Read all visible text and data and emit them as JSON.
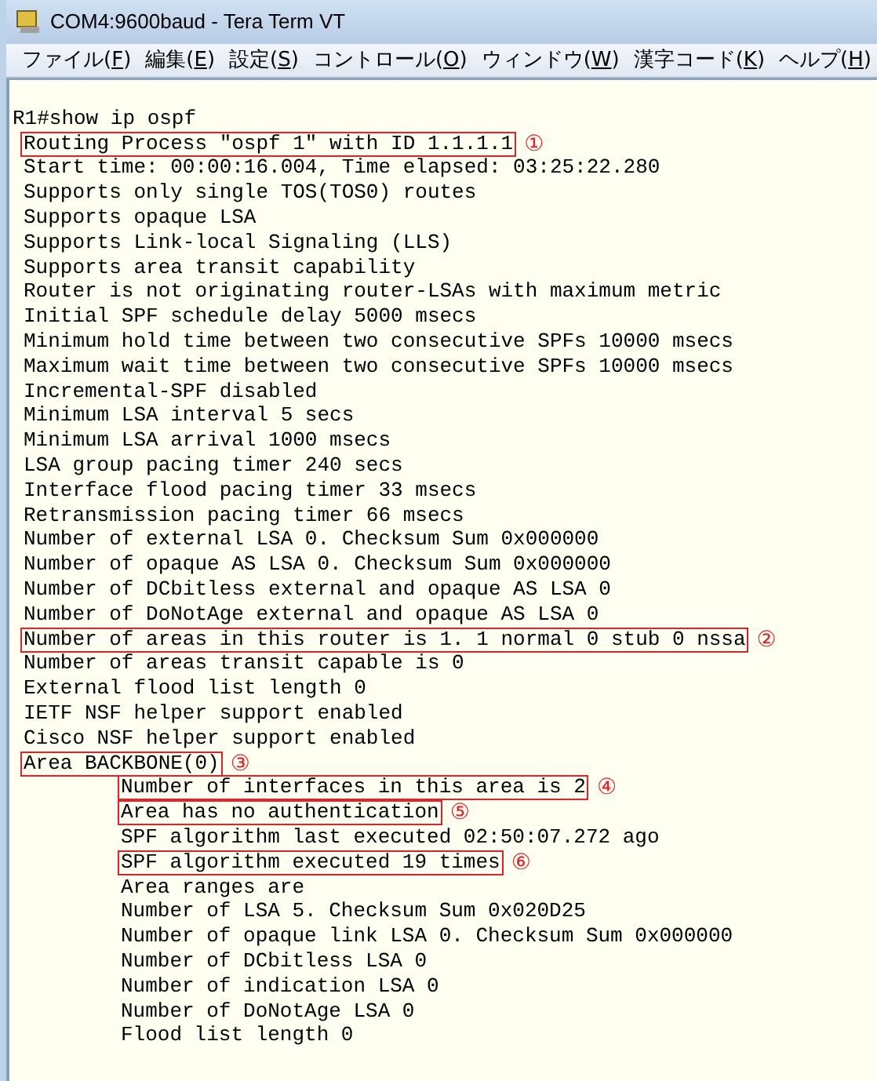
{
  "window": {
    "title": "COM4:9600baud - Tera Term VT"
  },
  "menu": [
    "ファイル(F)",
    "編集(E)",
    "設定(S)",
    "コントロール(O)",
    "ウィンドウ(W)",
    "漢字コード(K)",
    "ヘルプ(H)"
  ],
  "terminal": {
    "prompt": "R1#show ip ospf",
    "lines": [
      {
        "text": "Routing Process \"ospf 1\" with ID 1.1.1.1",
        "highlighted": true,
        "marker": "①"
      },
      {
        "text": "Start time: 00:00:16.004, Time elapsed: 03:25:22.280",
        "highlighted": false
      },
      {
        "text": "Supports only single TOS(TOS0) routes",
        "highlighted": false
      },
      {
        "text": "Supports opaque LSA",
        "highlighted": false
      },
      {
        "text": "Supports Link-local Signaling (LLS)",
        "highlighted": false
      },
      {
        "text": "Supports area transit capability",
        "highlighted": false
      },
      {
        "text": "Router is not originating router-LSAs with maximum metric",
        "highlighted": false
      },
      {
        "text": "Initial SPF schedule delay 5000 msecs",
        "highlighted": false
      },
      {
        "text": "Minimum hold time between two consecutive SPFs 10000 msecs",
        "highlighted": false
      },
      {
        "text": "Maximum wait time between two consecutive SPFs 10000 msecs",
        "highlighted": false
      },
      {
        "text": "Incremental-SPF disabled",
        "highlighted": false
      },
      {
        "text": "Minimum LSA interval 5 secs",
        "highlighted": false
      },
      {
        "text": "Minimum LSA arrival 1000 msecs",
        "highlighted": false
      },
      {
        "text": "LSA group pacing timer 240 secs",
        "highlighted": false
      },
      {
        "text": "Interface flood pacing timer 33 msecs",
        "highlighted": false
      },
      {
        "text": "Retransmission pacing timer 66 msecs",
        "highlighted": false
      },
      {
        "text": "Number of external LSA 0. Checksum Sum 0x000000",
        "highlighted": false
      },
      {
        "text": "Number of opaque AS LSA 0. Checksum Sum 0x000000",
        "highlighted": false
      },
      {
        "text": "Number of DCbitless external and opaque AS LSA 0",
        "highlighted": false
      },
      {
        "text": "Number of DoNotAge external and opaque AS LSA 0",
        "highlighted": false
      },
      {
        "text": "Number of areas in this router is 1. 1 normal 0 stub 0 nssa",
        "highlighted": true,
        "marker": "②"
      },
      {
        "text": "Number of areas transit capable is 0",
        "highlighted": false
      },
      {
        "text": "External flood list length 0",
        "highlighted": false
      },
      {
        "text": "IETF NSF helper support enabled",
        "highlighted": false
      },
      {
        "text": "Cisco NSF helper support enabled",
        "highlighted": false
      },
      {
        "text": "Area BACKBONE(0)",
        "highlighted": true,
        "marker": "③",
        "children": [
          {
            "text": "Number of interfaces in this area is 2",
            "highlighted": true,
            "marker": "④"
          },
          {
            "text": "Area has no authentication",
            "highlighted": true,
            "marker": "⑤"
          },
          {
            "text": "SPF algorithm last executed 02:50:07.272 ago",
            "highlighted": false
          },
          {
            "text": "SPF algorithm executed 19 times",
            "highlighted": true,
            "marker": "⑥"
          },
          {
            "text": "Area ranges are",
            "highlighted": false
          },
          {
            "text": "Number of LSA 5. Checksum Sum 0x020D25",
            "highlighted": false
          },
          {
            "text": "Number of opaque link LSA 0. Checksum Sum 0x000000",
            "highlighted": false
          },
          {
            "text": "Number of DCbitless LSA 0",
            "highlighted": false
          },
          {
            "text": "Number of indication LSA 0",
            "highlighted": false
          },
          {
            "text": "Number of DoNotAge LSA 0",
            "highlighted": false
          },
          {
            "text": "Flood list length 0",
            "highlighted": false
          }
        ]
      }
    ]
  }
}
